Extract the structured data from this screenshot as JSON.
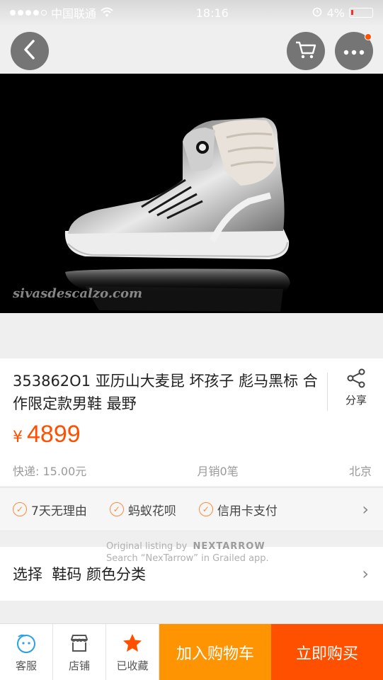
{
  "status_bar": {
    "carrier": "中国联通",
    "time": "18:16",
    "battery": "4%"
  },
  "product": {
    "watermark": "sivasdescalzo.com",
    "title": "353862O1 亚历山大麦昆 坏孩子 彪马黑标 合作限定款男鞋 最野",
    "share_label": "分享",
    "currency": "¥",
    "price": "4899",
    "shipping": "快递: 15.00元",
    "monthly_sales": "月销0笔",
    "location": "北京"
  },
  "services": [
    {
      "label": "7天无理由",
      "icon": "check-circle-icon"
    },
    {
      "label": "蚂蚁花呗",
      "icon": "check-circle-icon"
    },
    {
      "label": "信用卡支付",
      "icon": "check-circle-icon"
    }
  ],
  "select_options": {
    "label": "选择  鞋码 颜色分类"
  },
  "promo": {
    "line1": "Original listing by",
    "brand": "NEXTARROW",
    "line2": "Search “NexTarrow” in Grailed app."
  },
  "bottom_bar": {
    "service_label": "客服",
    "shop_label": "店铺",
    "favorite_label": "已收藏",
    "add_to_cart_label": "加入购物车",
    "buy_now_label": "立即购买"
  },
  "colors": {
    "accent": "#ff5000",
    "add_to_cart": "#ff9402"
  }
}
